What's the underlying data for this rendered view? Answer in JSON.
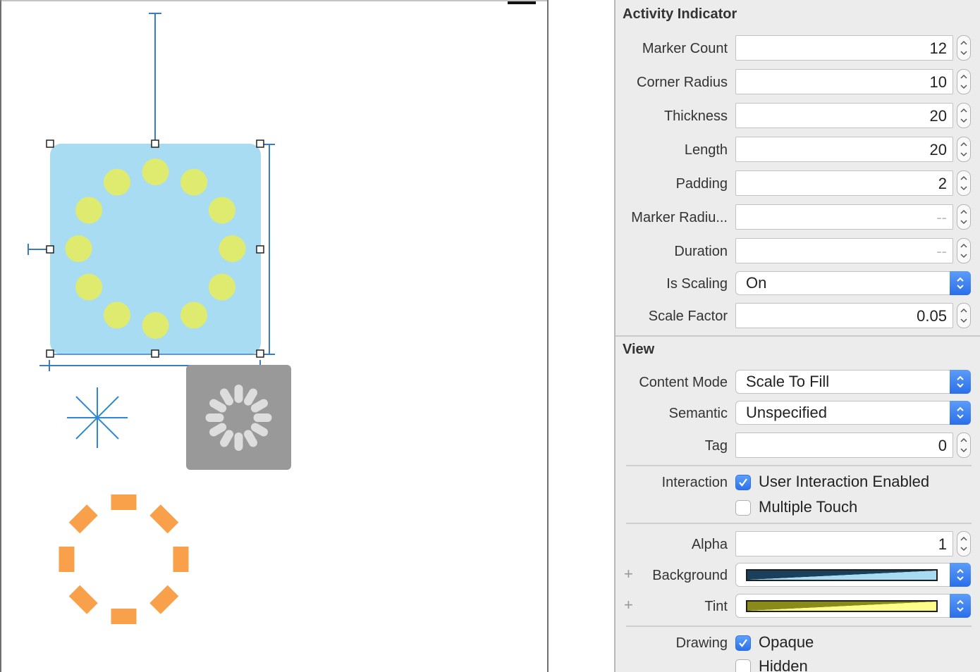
{
  "activity_indicator": {
    "title": "Activity Indicator",
    "rows": [
      {
        "label": "Marker Count",
        "value": "12"
      },
      {
        "label": "Corner Radius",
        "value": "10"
      },
      {
        "label": "Thickness",
        "value": "20"
      },
      {
        "label": "Length",
        "value": "20"
      },
      {
        "label": "Padding",
        "value": "2"
      },
      {
        "label": "Marker Radiu...",
        "value": "--"
      },
      {
        "label": "Duration",
        "value": "--"
      }
    ],
    "is_scaling": {
      "label": "Is Scaling",
      "value": "On"
    },
    "scale_factor": {
      "label": "Scale Factor",
      "value": "0.05"
    }
  },
  "view": {
    "title": "View",
    "content_mode": {
      "label": "Content Mode",
      "value": "Scale To Fill"
    },
    "semantic": {
      "label": "Semantic",
      "value": "Unspecified"
    },
    "tag": {
      "label": "Tag",
      "value": "0"
    },
    "interaction": {
      "label": "Interaction",
      "user_interaction": {
        "label": "User Interaction Enabled",
        "checked": true
      },
      "multiple_touch": {
        "label": "Multiple Touch",
        "checked": false
      }
    },
    "alpha": {
      "label": "Alpha",
      "value": "1"
    },
    "background": {
      "label": "Background",
      "plus": "+",
      "dark": "#1a3f5a",
      "light": "#a8daf0"
    },
    "tint": {
      "label": "Tint",
      "plus": "+",
      "dark": "#8a8a1a",
      "light": "#fdfd8a"
    },
    "drawing": {
      "label": "Drawing",
      "opaque": {
        "label": "Opaque",
        "checked": true
      },
      "hidden": {
        "label": "Hidden",
        "checked": false
      }
    }
  },
  "canvas": {
    "selected_view_color": "#a8dcf2",
    "marker_color": "#dfeb6e",
    "guide_color": "#3a7cc0",
    "spinner_bg": "#999999",
    "spinner_marker": "#dddddd",
    "orange_color": "#f9a04a",
    "star_color": "#2f87d9"
  }
}
